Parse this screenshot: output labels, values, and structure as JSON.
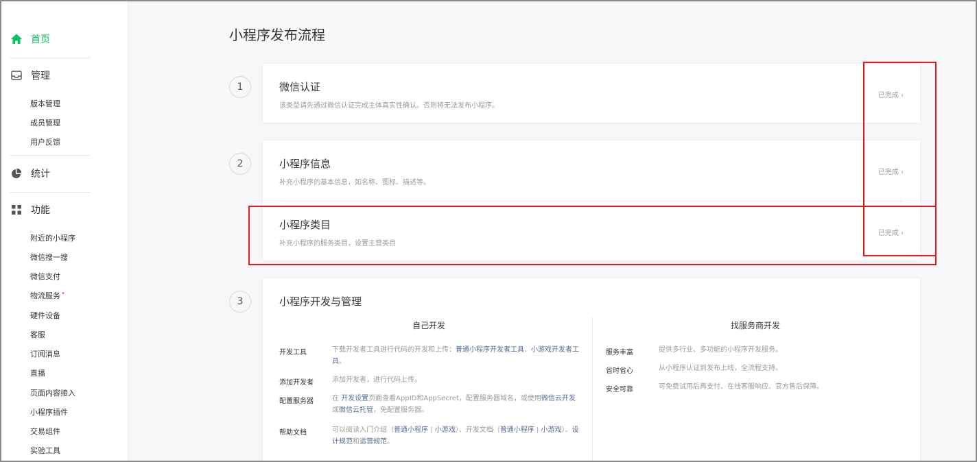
{
  "sidebar": {
    "home": "首页",
    "manage": {
      "label": "管理",
      "items": [
        "版本管理",
        "成员管理",
        "用户反馈"
      ]
    },
    "stats": {
      "label": "统计"
    },
    "features": {
      "label": "功能",
      "items": [
        "附近的小程序",
        "微信搜一搜",
        "微信支付",
        "物流服务",
        "硬件设备",
        "客服",
        "订阅消息",
        "直播",
        "页面内容接入",
        "小程序插件",
        "交易组件",
        "实验工具"
      ],
      "new_dot": "•"
    }
  },
  "page_title": "小程序发布流程",
  "steps": [
    {
      "num": "1",
      "items": [
        {
          "title": "微信认证",
          "desc": "该类型请先通过微信认证完成主体真实性确认。否则将无法发布小程序。",
          "status": "已完成"
        }
      ]
    },
    {
      "num": "2",
      "items": [
        {
          "title": "小程序信息",
          "desc": "补充小程序的基本信息，如名称、图标、描述等。",
          "status": "已完成"
        },
        {
          "title": "小程序类目",
          "desc": "补充小程序的服务类目，设置主营类目",
          "status": "已完成"
        }
      ]
    },
    {
      "num": "3",
      "title": "小程序开发与管理"
    }
  ],
  "status_arrow": "›",
  "dev_self": {
    "title": "自己开发",
    "rows": [
      {
        "label": "开发工具",
        "pre": "下载开发者工具进行代码的开发和上传：",
        "link1": "普通小程序开发者工具",
        "mid": "、",
        "link2": "小游戏开发者工具",
        "post": "。"
      },
      {
        "label": "添加开发者",
        "text": "添加开发者，进行代码上传。"
      },
      {
        "label": "配置服务器",
        "pre": "在 ",
        "link1": "开发设置",
        "mid": "页面查看AppID和AppSecret，配置服务器域名，或使用",
        "link2": "微信云开发",
        "mid2": "或",
        "link3": "微信云托管",
        "post": "，免配置服务器。"
      },
      {
        "label": "帮助文档",
        "pre": "可以阅读入门介绍（",
        "link1": "普通小程序",
        "sep1": "|",
        "link2": "小游戏",
        "mid": "）、开发文档（",
        "link3": "普通小程序",
        "sep2": "|",
        "link4": "小游戏",
        "mid2": "）、",
        "link5": "设计规范",
        "and": "和",
        "link6": "运营规范",
        "post": "。"
      }
    ]
  },
  "dev_provider": {
    "title": "找服务商开发",
    "rows": [
      {
        "label": "服务丰富",
        "text": "提供多行业、多功能的小程序开发服务。"
      },
      {
        "label": "省时省心",
        "text": "从小程序认证到发布上线，全流程支持。"
      },
      {
        "label": "安全可靠",
        "text": "可免费试用后再支付、在线客服响应、官方售后保障。"
      }
    ]
  },
  "colors": {
    "accent": "#07c160",
    "link": "#576b95",
    "annotation": "#e8191a"
  }
}
